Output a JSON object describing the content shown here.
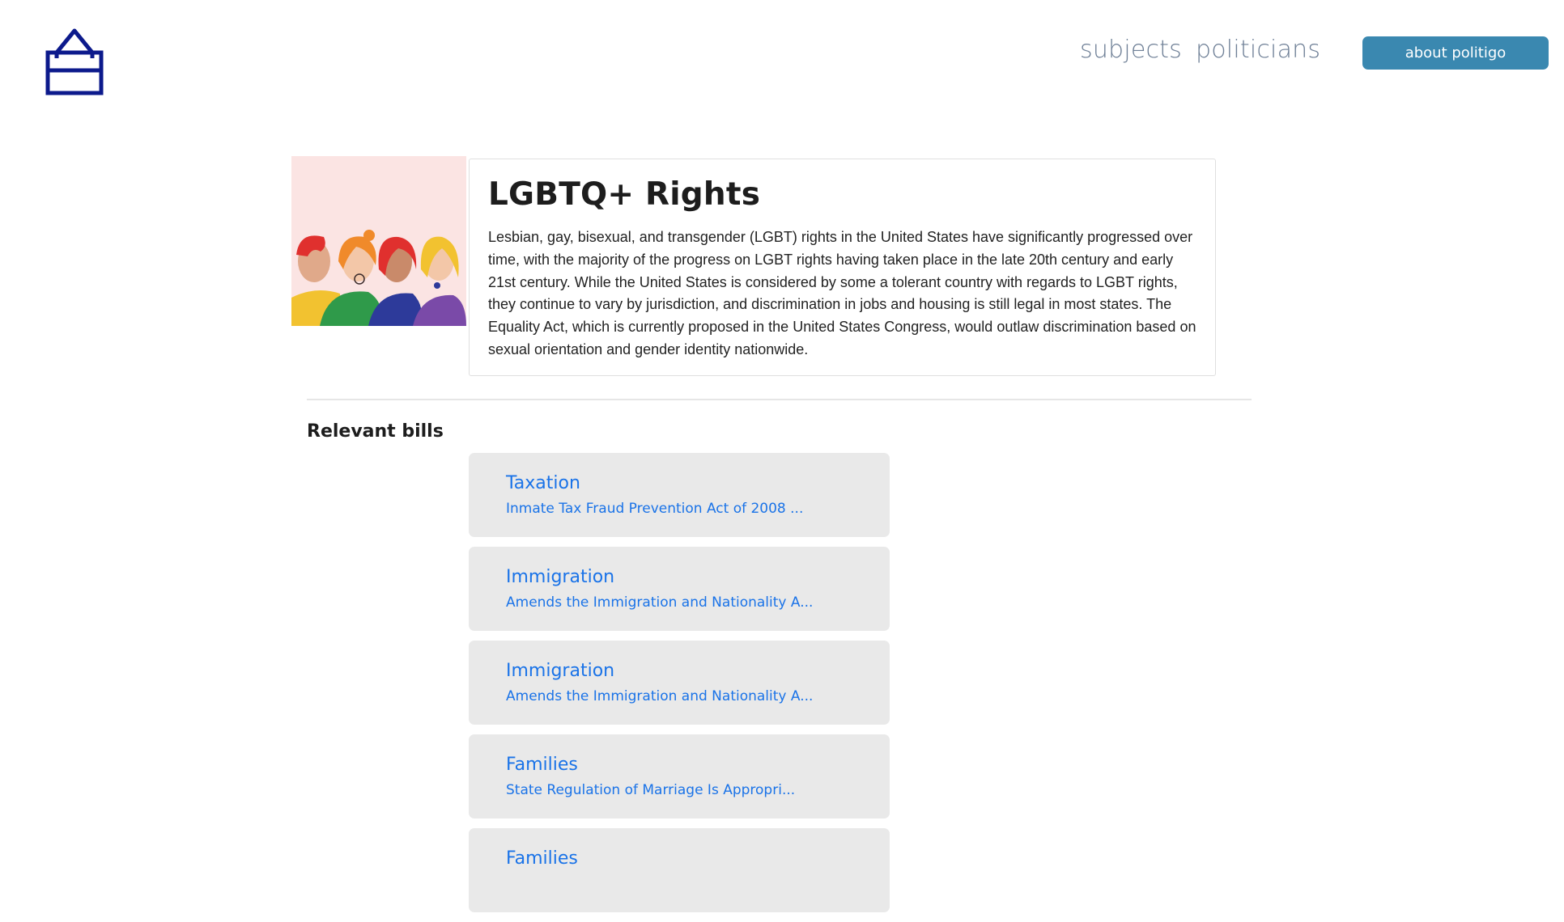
{
  "header": {
    "logo_icon": "ballot-box-icon",
    "nav": [
      {
        "label": "subjects"
      },
      {
        "label": "politicians"
      }
    ],
    "about_button": "about politigo"
  },
  "subject": {
    "title": "LGBTQ+ Rights",
    "image_icon": "people-illustration",
    "description": "Lesbian, gay, bisexual, and transgender (LGBT) rights in the United States have significantly progressed over time, with the majority of the progress on LGBT rights having taken place in the late 20th century and early 21st century. While the United States is considered by some a tolerant country with regards to LGBT rights, they continue to vary by jurisdiction, and discrimination in jobs and housing is still legal in most states. The Equality Act, which is currently proposed in the United States Congress, would outlaw discrimination based on sexual orientation and gender identity nationwide."
  },
  "relevant_bills": {
    "heading": "Relevant bills",
    "items": [
      {
        "subject": "Taxation",
        "title": "Inmate Tax Fraud Prevention Act of 2008 ..."
      },
      {
        "subject": "Immigration",
        "title": "Amends the Immigration and Nationality A..."
      },
      {
        "subject": "Immigration",
        "title": "Amends the Immigration and Nationality A..."
      },
      {
        "subject": "Families",
        "title": "State Regulation of Marriage Is Appropri..."
      },
      {
        "subject": "Families",
        "title": ""
      }
    ]
  },
  "colors": {
    "link_blue": "#1a73e8",
    "button_blue": "#3a88b0",
    "logo_navy": "#0c1a8c",
    "card_gray": "#e9e9e9"
  }
}
